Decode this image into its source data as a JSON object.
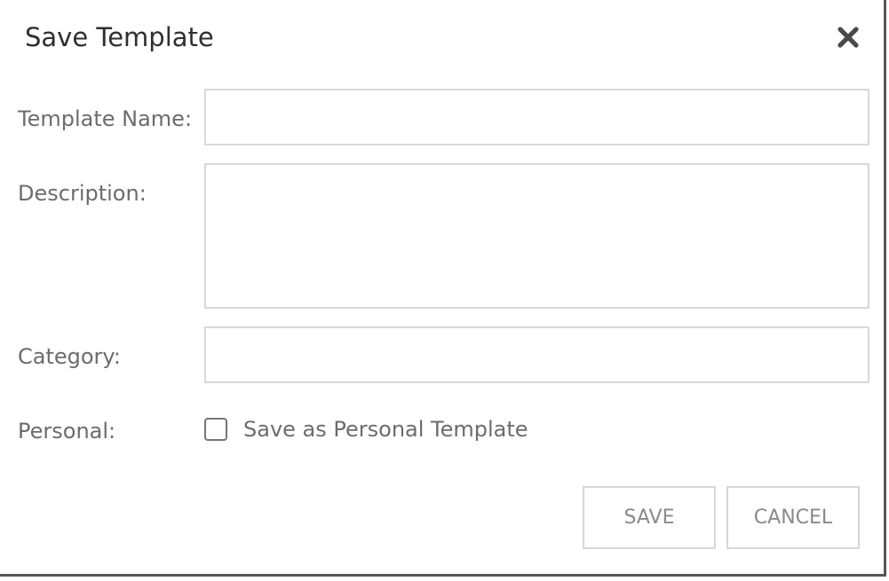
{
  "dialog": {
    "title": "Save Template",
    "close_icon": "close-icon"
  },
  "form": {
    "template_name": {
      "label": "Template Name:",
      "value": "",
      "placeholder": ""
    },
    "description": {
      "label": "Description:",
      "value": "",
      "placeholder": ""
    },
    "category": {
      "label": "Category:",
      "value": "",
      "placeholder": ""
    },
    "personal": {
      "label": "Personal:",
      "checkbox_label": "Save as Personal Template",
      "checked": false
    }
  },
  "actions": {
    "save_label": "SAVE",
    "cancel_label": "CANCEL"
  },
  "colors": {
    "title": "#2f2f2f",
    "label": "#6c6c6c",
    "input_border": "#d8d8d8",
    "button_text": "#8a8a8a",
    "dialog_shadow": "#565656"
  }
}
